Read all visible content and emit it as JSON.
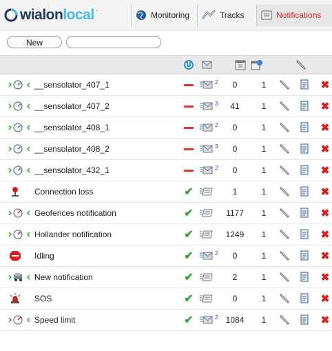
{
  "logo": {
    "text_a": "wialon",
    "text_b": "local",
    "sup": "·"
  },
  "tabs": [
    {
      "label": "Monitoring",
      "icon": "globe-icon",
      "active": false
    },
    {
      "label": "Tracks",
      "icon": "tracks-icon",
      "active": false
    },
    {
      "label": "Notifications",
      "icon": "notifications-icon",
      "active": true
    }
  ],
  "toolbar": {
    "new_label": "New",
    "search_placeholder": ""
  },
  "header_icons": [
    "power-icon",
    "notification-type-icon",
    "calendar-icon",
    "calendar-settings-icon",
    "wrench-icon"
  ],
  "colors": {
    "accent_red": "#d42a2a",
    "check_green": "#3aa53a",
    "dash_red": "#e03535",
    "logo_dark": "#1f3a5c",
    "logo_light": "#4db7e8"
  },
  "rows": [
    {
      "icon": "sensor-gauge-icon",
      "name": "__sensolator_407_1",
      "enabled": false,
      "type": "sms-email-icon",
      "type_sup": "2",
      "count": "0",
      "one": "1"
    },
    {
      "icon": "sensor-gauge-icon",
      "name": "__sensolator_407_2",
      "enabled": false,
      "type": "sms-email-icon",
      "type_sup": "3",
      "count": "41",
      "one": "1"
    },
    {
      "icon": "sensor-gauge-icon",
      "name": "__sensolator_408_1",
      "enabled": false,
      "type": "sms-email-icon",
      "type_sup": "2",
      "count": "0",
      "one": "1"
    },
    {
      "icon": "sensor-gauge-icon",
      "name": "__sensolator_408_2",
      "enabled": false,
      "type": "sms-email-icon",
      "type_sup": "3",
      "count": "0",
      "one": "1"
    },
    {
      "icon": "sensor-gauge-icon",
      "name": "__sensolator_432_1",
      "enabled": false,
      "type": "sms-email-icon",
      "type_sup": "2",
      "count": "0",
      "one": "1"
    },
    {
      "icon": "connection-loss-icon",
      "name": "Connection loss",
      "enabled": true,
      "type": "list-icon",
      "type_sup": "",
      "count": "1",
      "one": "1"
    },
    {
      "icon": "speed-gauge-icon",
      "name": "Geofences notification",
      "enabled": true,
      "type": "list-icon",
      "type_sup": "",
      "count": "1177",
      "one": "1"
    },
    {
      "icon": "speed-gauge-icon",
      "name": "Hollander notification",
      "enabled": true,
      "type": "list-icon",
      "type_sup": "",
      "count": "1249",
      "one": "1"
    },
    {
      "icon": "stop-sign-icon",
      "name": "Idling",
      "enabled": true,
      "type": "sms-email-icon",
      "type_sup": "2",
      "count": "0",
      "one": "1"
    },
    {
      "icon": "vehicle-icon",
      "name": "New notification",
      "enabled": true,
      "type": "list-icon",
      "type_sup": "",
      "count": "2",
      "one": "1"
    },
    {
      "icon": "sos-siren-icon",
      "name": "SOS",
      "enabled": true,
      "type": "list-icon",
      "type_sup": "",
      "count": "0",
      "one": "1"
    },
    {
      "icon": "speed-gauge-icon",
      "name": "Speed limit",
      "enabled": true,
      "type": "sms-email-icon",
      "type_sup": "2",
      "count": "1084",
      "one": "1"
    }
  ]
}
